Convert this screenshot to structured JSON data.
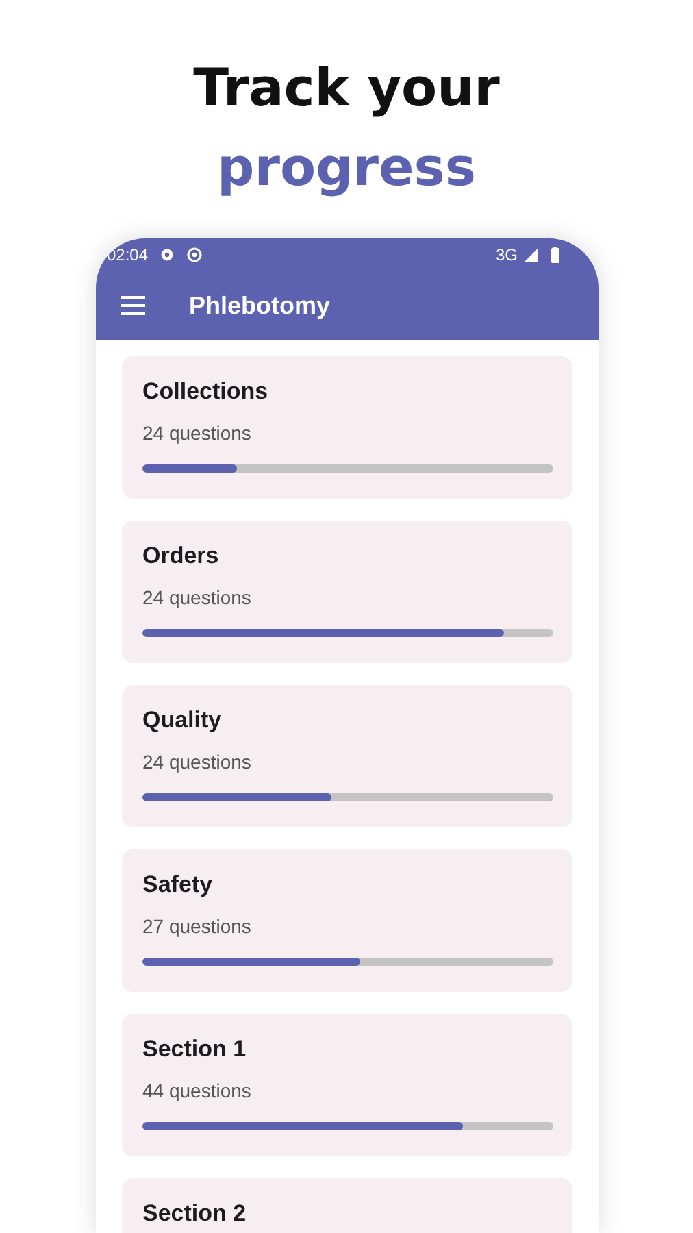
{
  "headline": {
    "line_1": "Track your",
    "line_2": "progress"
  },
  "status_bar": {
    "time": "02:04",
    "network": "3G"
  },
  "app_bar": {
    "title": "Phlebotomy"
  },
  "categories": [
    {
      "title": "Collections",
      "subtitle": "24 questions",
      "level": 0.23
    },
    {
      "title": "Orders",
      "subtitle": "24 questions",
      "level": 0.88
    },
    {
      "title": "Quality",
      "subtitle": "24 questions",
      "level": 0.46
    },
    {
      "title": "Safety",
      "subtitle": "27 questions",
      "level": 0.53
    },
    {
      "title": "Section 1",
      "subtitle": "44 questions",
      "level": 0.78
    },
    {
      "title": "Section 2"
    }
  ]
}
